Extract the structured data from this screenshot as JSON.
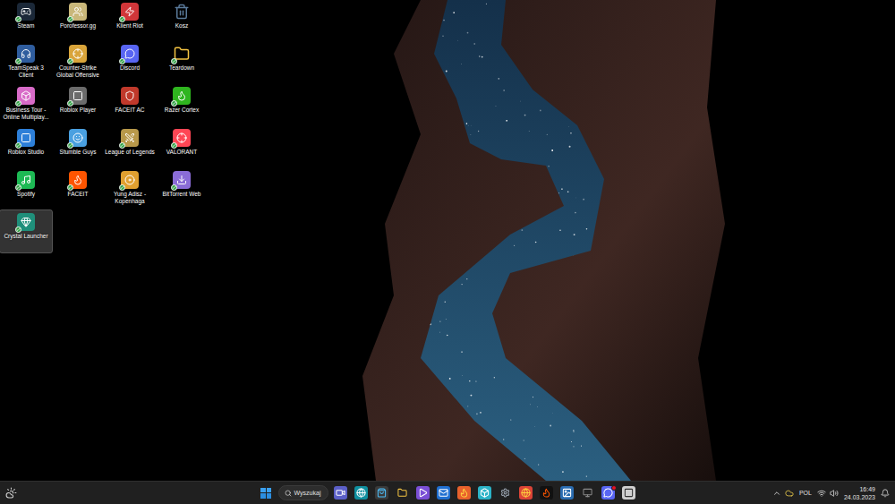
{
  "desktop": {
    "icons": [
      {
        "label": "Steam",
        "kind": "steam",
        "selected": false,
        "synced": true,
        "color": "#1b2838"
      },
      {
        "label": "Porofessor.gg",
        "kind": "porofessor",
        "selected": false,
        "synced": true,
        "color": "#c9b77a"
      },
      {
        "label": "Klient Riot",
        "kind": "riot",
        "selected": false,
        "synced": true,
        "color": "#d13639"
      },
      {
        "label": "Kosz",
        "kind": "trash",
        "selected": false,
        "synced": false,
        "color": "#5a7a9a"
      },
      {
        "label": "TeamSpeak 3 Client",
        "kind": "teamspeak",
        "selected": false,
        "synced": true,
        "color": "#2f5d9e"
      },
      {
        "label": "Counter-Strike Global Offensive",
        "kind": "csgo",
        "selected": false,
        "synced": true,
        "color": "#d9a43a"
      },
      {
        "label": "Discord",
        "kind": "discord",
        "selected": false,
        "synced": true,
        "color": "#5865f2"
      },
      {
        "label": "Teardown",
        "kind": "folder",
        "selected": false,
        "synced": true,
        "color": "#f5c542"
      },
      {
        "label": "Business Tour - Online Multiplay...",
        "kind": "boardgame",
        "selected": false,
        "synced": true,
        "color": "#d86bc8"
      },
      {
        "label": "Roblox Player",
        "kind": "roblox",
        "selected": false,
        "synced": true,
        "color": "#6b6b6b"
      },
      {
        "label": "FACEIT AC",
        "kind": "faceitac",
        "selected": false,
        "synced": false,
        "color": "#c0392b"
      },
      {
        "label": "Razer Cortex",
        "kind": "razer",
        "selected": false,
        "synced": true,
        "color": "#2fb51f"
      },
      {
        "label": "Roblox Studio",
        "kind": "robloxstudio",
        "selected": false,
        "synced": true,
        "color": "#2d7fd8"
      },
      {
        "label": "Stumble Guys",
        "kind": "stumble",
        "selected": false,
        "synced": true,
        "color": "#4aa0e0"
      },
      {
        "label": "League of Legends",
        "kind": "league",
        "selected": false,
        "synced": true,
        "color": "#b8984a"
      },
      {
        "label": "VALORANT",
        "kind": "valorant",
        "selected": false,
        "synced": true,
        "color": "#ff4655"
      },
      {
        "label": "Spotify",
        "kind": "spotify",
        "selected": false,
        "synced": true,
        "color": "#1db954"
      },
      {
        "label": "FACEIT",
        "kind": "faceit",
        "selected": false,
        "synced": true,
        "color": "#ff5500"
      },
      {
        "label": "Yung Adisz - Kopenhaga",
        "kind": "music",
        "selected": false,
        "synced": true,
        "color": "#e0a030"
      },
      {
        "label": "BitTorrent Web",
        "kind": "bittorrent",
        "selected": false,
        "synced": true,
        "color": "#8a6cd6"
      },
      {
        "label": "Crystal Launcher",
        "kind": "crystal",
        "selected": true,
        "synced": true,
        "color": "#1f8f7a"
      }
    ]
  },
  "taskbar": {
    "search": {
      "placeholder": "Wyszukaj"
    },
    "apps": [
      {
        "kind": "teams",
        "badge": false
      },
      {
        "kind": "edge",
        "badge": false
      },
      {
        "kind": "store",
        "badge": false
      },
      {
        "kind": "explorer",
        "badge": false
      },
      {
        "kind": "clipchamp",
        "badge": false
      },
      {
        "kind": "mail",
        "badge": false
      },
      {
        "kind": "firefox",
        "badge": false
      },
      {
        "kind": "launcher",
        "badge": false
      },
      {
        "kind": "settings",
        "badge": false
      },
      {
        "kind": "chrome",
        "badge": false
      },
      {
        "kind": "faceit",
        "badge": false
      },
      {
        "kind": "photos",
        "badge": false
      },
      {
        "kind": "monitor",
        "badge": false
      },
      {
        "kind": "discord",
        "badge": true
      },
      {
        "kind": "roblox",
        "badge": false
      }
    ]
  },
  "tray": {
    "language": "POL",
    "time": "16:49",
    "date": "24.03.2023"
  }
}
